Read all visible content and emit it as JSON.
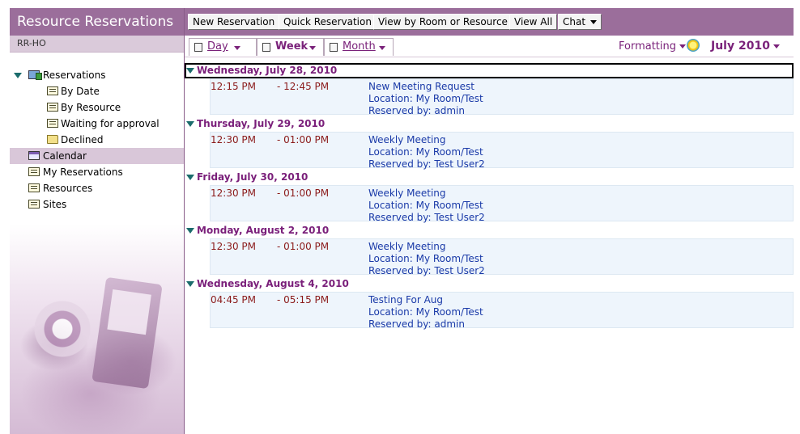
{
  "app": {
    "title": "Resource Reservations",
    "db_name": "RR-HO"
  },
  "nav": {
    "items": [
      {
        "label": "Reservations",
        "icon": "reservations-icon",
        "level": 0,
        "expanded": true
      },
      {
        "label": "By Date",
        "icon": "view-icon",
        "level": 1
      },
      {
        "label": "By Resource",
        "icon": "view-icon",
        "level": 1
      },
      {
        "label": "Waiting for approval",
        "icon": "view-icon",
        "level": 1
      },
      {
        "label": "Declined",
        "icon": "folder-icon",
        "level": 1
      },
      {
        "label": "Calendar",
        "icon": "calendar-icon",
        "level": 0,
        "selected": true
      },
      {
        "label": "My Reservations",
        "icon": "view-icon",
        "level": 0
      },
      {
        "label": "Resources",
        "icon": "view-icon",
        "level": 0
      },
      {
        "label": "Sites",
        "icon": "view-icon",
        "level": 0
      }
    ]
  },
  "toolbar": {
    "new_reservation": "New Reservation",
    "quick_reservation": "Quick Reservation",
    "view_by_room": "View by Room or Resource",
    "view_all": "View All",
    "chat": "Chat"
  },
  "viewbar": {
    "day": "Day",
    "week": "Week",
    "month": "Month",
    "formatting": "Formatting",
    "current_month": "July 2010"
  },
  "days": [
    {
      "date": "Wednesday, July 28, 2010",
      "entries": [
        {
          "start": "12:15 PM",
          "end": "- 12:45 PM",
          "subject": "New Meeting Request",
          "location": "Location: My Room/Test",
          "reserved_by": "Reserved by: admin"
        }
      ]
    },
    {
      "date": "Thursday, July 29, 2010",
      "entries": [
        {
          "start": "12:30 PM",
          "end": "- 01:00 PM",
          "subject": "Weekly Meeting",
          "location": "Location: My Room/Test",
          "reserved_by": "Reserved by: Test User2"
        }
      ]
    },
    {
      "date": "Friday, July 30, 2010",
      "entries": [
        {
          "start": "12:30 PM",
          "end": "- 01:00 PM",
          "subject": "Weekly Meeting",
          "location": "Location: My Room/Test",
          "reserved_by": "Reserved by: Test User2"
        }
      ]
    },
    {
      "date": "Monday, August 2, 2010",
      "entries": [
        {
          "start": "12:30 PM",
          "end": "- 01:00 PM",
          "subject": "Weekly Meeting",
          "location": "Location: My Room/Test",
          "reserved_by": "Reserved by: Test User2"
        }
      ]
    },
    {
      "date": "Wednesday, August 4, 2010",
      "entries": [
        {
          "start": "04:45 PM",
          "end": "- 05:15 PM",
          "subject": "Testing For Aug",
          "location": "Location: My Room/Test",
          "reserved_by": "Reserved by: admin"
        }
      ]
    }
  ],
  "colors": {
    "brand": "#9b6e9b",
    "accent_text": "#7a227a",
    "time_text": "#8b1a1a",
    "entry_text": "#1a3aa8",
    "entry_bg": "#eef5fc"
  }
}
